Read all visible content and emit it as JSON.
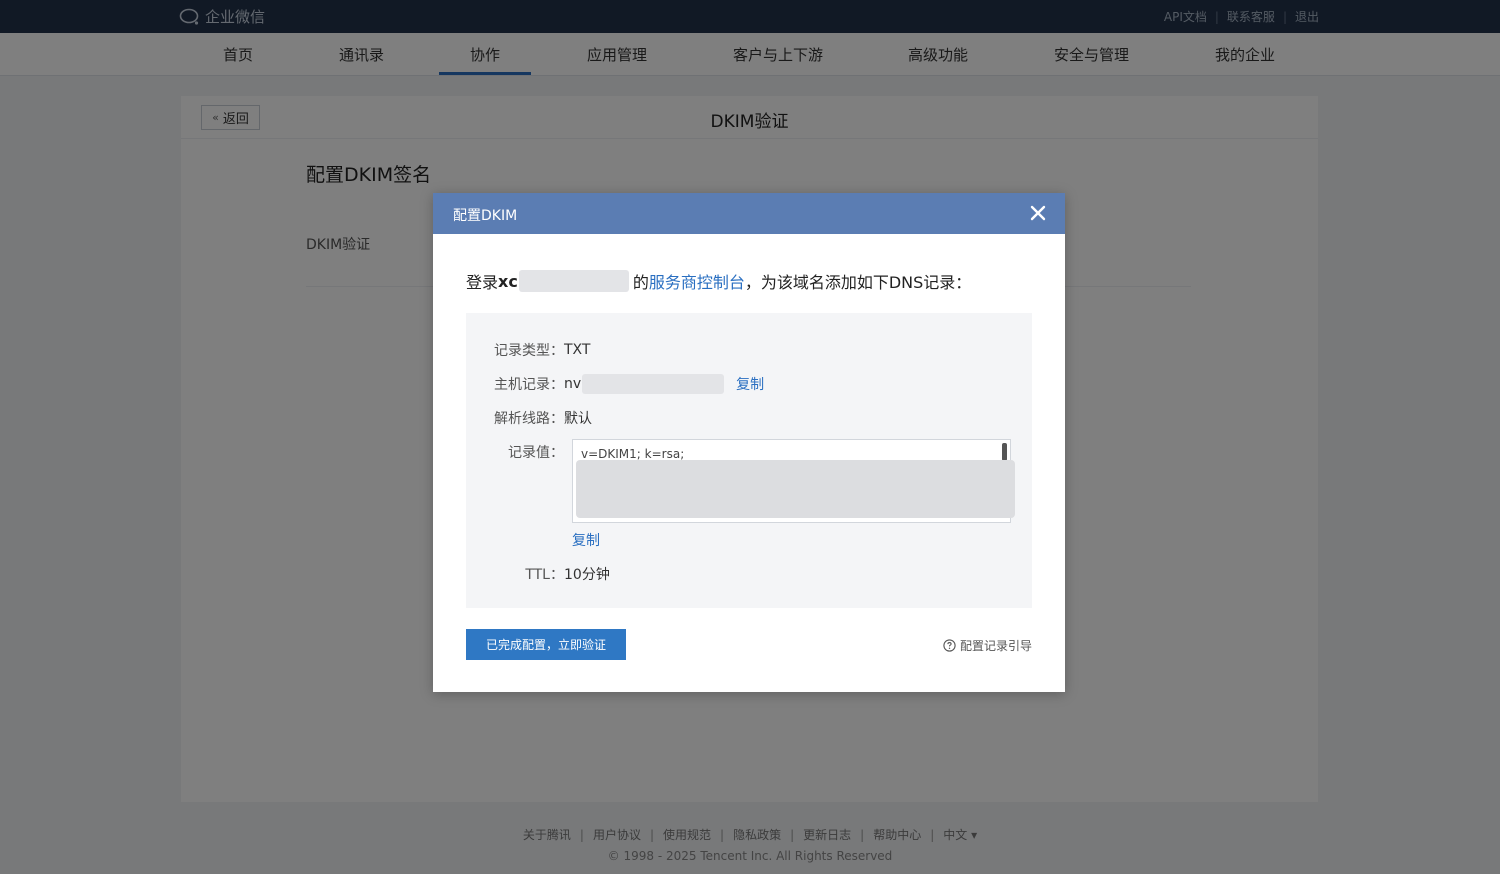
{
  "app": {
    "logo_text": "企业微信"
  },
  "top_links": [
    "API文档",
    "联系客服",
    "退出"
  ],
  "nav": {
    "items": [
      "首页",
      "通讯录",
      "协作",
      "应用管理",
      "客户与上下游",
      "高级功能",
      "安全与管理",
      "我的企业"
    ],
    "active_index": 2
  },
  "page": {
    "back_label": "返回",
    "title": "DKIM验证",
    "section_title": "配置DKIM签名",
    "row_label": "DKIM验证"
  },
  "footer": {
    "links": [
      "关于腾讯",
      "用户协议",
      "使用规范",
      "隐私政策",
      "更新日志",
      "帮助中心",
      "中文 ▾"
    ],
    "copyright": "© 1998 - 2025 Tencent Inc. All Rights Reserved"
  },
  "modal": {
    "title": "配置DKIM",
    "instruction_prefix": "登录 ",
    "domain_visible": "xc",
    "instruction_mid": "的",
    "console_link": "服务商控制台",
    "instruction_suffix": "，为该域名添加如下DNS记录：",
    "record_type_label": "记录类型：",
    "record_type_value": "TXT",
    "host_label": "主机记录：",
    "host_value": "nv",
    "host_copy": "复制",
    "route_label": "解析线路：",
    "route_value": "默认",
    "value_label": "记录值：",
    "value_text": "v=DKIM1; k=rsa;",
    "value_copy": "复制",
    "ttl_label": "TTL：",
    "ttl_value": "10分钟",
    "confirm_button": "已完成配置，立即验证",
    "guide_link": "配置记录引导"
  },
  "colors": {
    "topbar": "#22324b",
    "modal_header": "#5b7db3",
    "primary": "#2f78c4",
    "link": "#2a6fc1"
  }
}
